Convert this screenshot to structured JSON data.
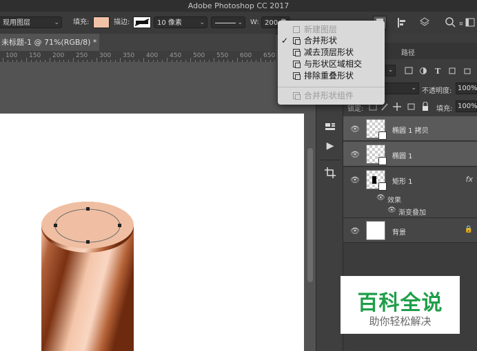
{
  "app": {
    "title": "Adobe Photoshop CC 2017"
  },
  "options_bar": {
    "mode_value": "现用图层",
    "fill_label": "填充:",
    "fill_color": "#f2c2a8",
    "stroke_label": "描边:",
    "stroke_width": "10 像素",
    "w_label": "W:",
    "w_value": "200 像"
  },
  "document_tab": {
    "label": "未标题-1 @ 71%(RGB/8) *"
  },
  "ruler": {
    "labels": [
      "100",
      "150",
      "200",
      "250",
      "300",
      "350",
      "400",
      "450",
      "500",
      "550",
      "600",
      "650"
    ]
  },
  "menu": {
    "items": [
      {
        "label": "新建图层",
        "checked": false,
        "disabled": true
      },
      {
        "label": "合并形状",
        "checked": true,
        "disabled": false
      },
      {
        "label": "减去顶层形状",
        "checked": false,
        "disabled": false
      },
      {
        "label": "与形状区域相交",
        "checked": false,
        "disabled": false
      },
      {
        "label": "排除重叠形状",
        "checked": false,
        "disabled": false
      },
      {
        "label": "合并形状组件",
        "checked": false,
        "disabled": true
      }
    ],
    "check_mark": "✓"
  },
  "layers_panel": {
    "tab_paths": "路径",
    "opacity_label": "不透明度:",
    "opacity_value": "100%",
    "lock_label": "锁定:",
    "fill_label": "填充:",
    "fill_value": "100%",
    "layers": [
      {
        "name": "椭圆 1 拷贝",
        "selected": true
      },
      {
        "name": "椭圆 1",
        "selected": true
      },
      {
        "name": "矩形 1",
        "selected": false,
        "fx": "fx"
      },
      {
        "name": "背景",
        "selected": false
      }
    ],
    "effects_label": "效果",
    "gradient_overlay_label": "渐变叠加"
  },
  "watermark": {
    "title": "百科全说",
    "subtitle": "助你轻松解决"
  },
  "colors": {
    "skin_light": "#f2c2a8",
    "skin_dark": "#8a3a14",
    "watermark_green": "#1f9e49"
  }
}
